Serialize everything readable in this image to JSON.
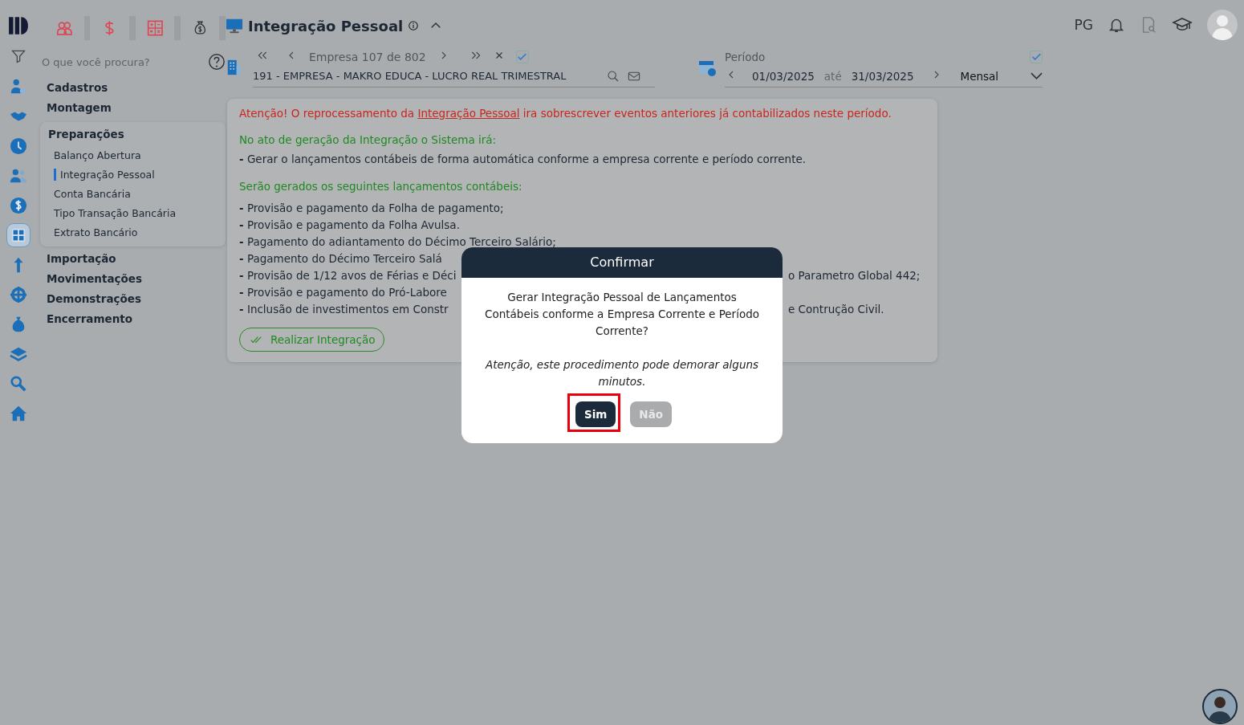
{
  "nav": [
    {
      "selected": false
    },
    {
      "selected": false
    },
    {
      "selected": false
    },
    {
      "selected": false
    },
    {
      "selected": false
    },
    {
      "selected": true
    },
    {
      "selected": false
    },
    {
      "selected": false
    },
    {
      "selected": false
    },
    {
      "selected": false
    },
    {
      "selected": false
    },
    {
      "selected": false
    }
  ],
  "search": {
    "placeholder": "O que você procura?"
  },
  "menu": [
    {
      "label": "Cadastros",
      "expanded": false
    },
    {
      "label": "Montagem",
      "expanded": false
    },
    {
      "label": "Preparações",
      "expanded": true,
      "children": [
        {
          "label": "Balanço Abertura",
          "selected": false
        },
        {
          "label": "Integração Pessoal",
          "selected": true
        },
        {
          "label": "Conta Bancária",
          "selected": false
        },
        {
          "label": "Tipo Transação Bancária",
          "selected": false
        },
        {
          "label": "Extrato Bancário",
          "selected": false
        }
      ]
    },
    {
      "label": "Importação",
      "expanded": false
    },
    {
      "label": "Movimentações",
      "expanded": false
    },
    {
      "label": "Demonstrações",
      "expanded": false
    },
    {
      "label": "Encerramento",
      "expanded": false
    }
  ],
  "page": {
    "title": "Integração Pessoal",
    "expanded": true
  },
  "company": {
    "pager": "Empresa 107 de 802",
    "name": "191 - EMPRESA - MAKRO EDUCA - LUCRO REAL TRIMESTRAL",
    "checked": true
  },
  "period": {
    "label": "Período",
    "from": "01/03/2025",
    "separator": "até",
    "to": "31/03/2025",
    "mode": "Mensal",
    "checked": true
  },
  "user": {
    "initials": "PG"
  },
  "card": {
    "warning": {
      "before": "Atenção! O reprocessamento da ",
      "link": "Integração Pessoal",
      "after": " ira sobrescrever eventos anteriores já contabilizados neste período."
    },
    "section_1": {
      "title": "No ato de geração da Integração o Sistema irá:",
      "lines": [
        "**-** Gerar o lançamentos contábeis de forma automática conforme a empresa corrente e período corrente."
      ]
    },
    "section_2": {
      "title": "Serão gerados os seguintes lançamentos contábeis:",
      "lines": [
        {
          "text": "**-** Provisão e pagamento da Folha de pagamento;"
        },
        {
          "text": "**-** Provisão e pagamento da Folha Avulsa."
        },
        {
          "text": "**-** Pagamento do adiantamento do Décimo Terceiro Salário;"
        },
        {
          "text": "**-** Pagamento do Décimo Terceiro Salá"
        },
        {
          "text": "**-** Provisão de 1/12 avos de Férias e Déci",
          "continuation": "o Parametro Global 442;"
        },
        {
          "text": "**-** Provisão e pagamento do Pró-Labore"
        },
        {
          "text": "**-** Inclusão de investimentos em Constr",
          "continuation": "e Contrução Civil."
        }
      ]
    },
    "action": "Realizar Integração"
  },
  "dialog": {
    "title": "Confirmar",
    "message": "Gerar Integração Pessoal de Lançamentos Contábeis conforme a Empresa Corrente e Período Corrente?",
    "note": "Atenção, este procedimento pode demorar alguns minutos.",
    "buttons": [
      {
        "label": "Sim",
        "kind": "primary",
        "highlighted": true
      },
      {
        "label": "Não",
        "kind": "secondary",
        "highlighted": false
      }
    ]
  }
}
